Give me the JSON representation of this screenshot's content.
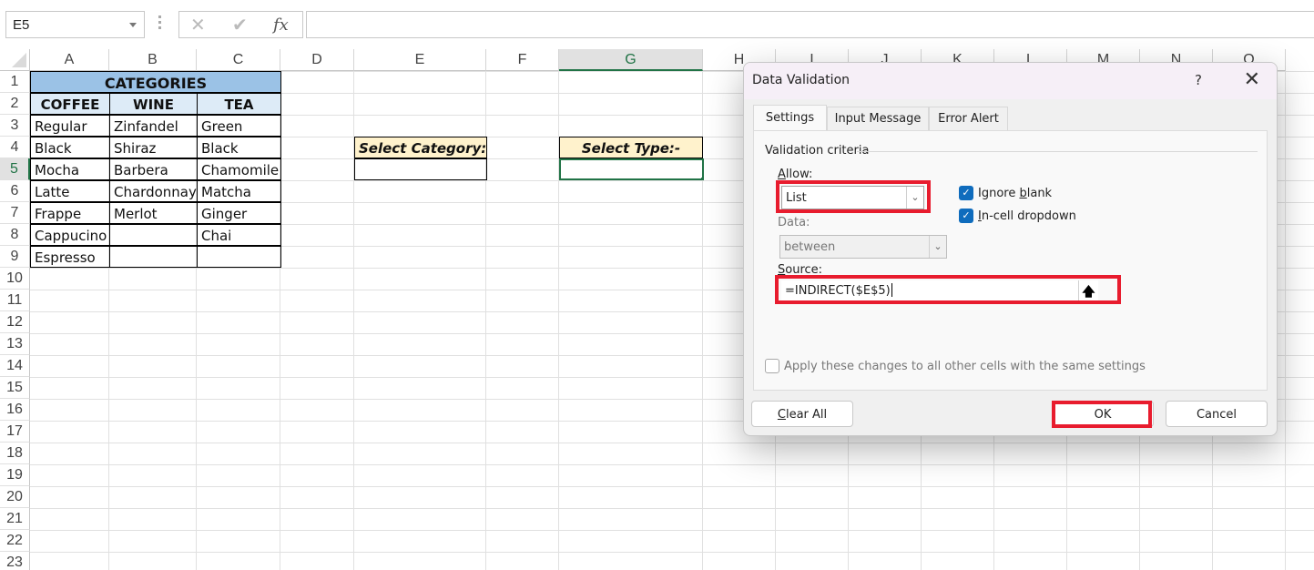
{
  "formula_bar": {
    "name_box": "E5",
    "cancel_icon": "✕",
    "enter_icon": "✔",
    "fx_icon": "fx",
    "formula": ""
  },
  "sheet": {
    "columns": [
      "A",
      "B",
      "C",
      "D",
      "E",
      "F",
      "G",
      "H",
      "I",
      "J",
      "K",
      "L",
      "M",
      "N",
      "O"
    ],
    "rows": [
      "1",
      "2",
      "3",
      "4",
      "5",
      "6",
      "7",
      "8",
      "9",
      "10",
      "11",
      "12",
      "13",
      "14",
      "15",
      "16",
      "17",
      "18",
      "19",
      "20",
      "21",
      "22",
      "23"
    ],
    "selected_column": "G",
    "selected_row": "5",
    "title": "CATEGORIES",
    "headers": [
      "COFFEE",
      "WINE",
      "TEA"
    ],
    "coffee": [
      "Regular",
      "Black",
      "Mocha",
      "Latte",
      "Frappe",
      "Cappucino",
      "Espresso"
    ],
    "wine": [
      "Zinfandel",
      "Shiraz",
      "Barbera",
      "Chardonnay",
      "Merlot",
      "",
      ""
    ],
    "tea": [
      "Green",
      "Black",
      "Chamomile",
      "Matcha",
      "Ginger",
      "Chai",
      ""
    ],
    "select_category_label": "Select Category:-",
    "select_category_value": "",
    "select_type_label": "Select Type:-",
    "select_type_value": ""
  },
  "dialog": {
    "title": "Data Validation",
    "help_icon": "?",
    "close_icon": "✕",
    "tabs": [
      {
        "label": "Settings",
        "active": true
      },
      {
        "label": "Input Message",
        "active": false
      },
      {
        "label": "Error Alert",
        "active": false
      }
    ],
    "section_label": "Validation criteria",
    "allow_label": "Allow:",
    "allow_value": "List",
    "data_label": "Data:",
    "data_value": "between",
    "ignore_blank_label": "Ignore blank",
    "ignore_blank_checked": true,
    "in_cell_dropdown_label": "In-cell dropdown",
    "in_cell_dropdown_checked": true,
    "source_label": "Source:",
    "source_value": "=INDIRECT($E$5)",
    "apply_all_label": "Apply these changes to all other cells with the same settings",
    "apply_all_checked": false,
    "clear_all_label": "Clear All",
    "ok_label": "OK",
    "cancel_label": "Cancel",
    "highlight_color": "#e81c2e"
  }
}
